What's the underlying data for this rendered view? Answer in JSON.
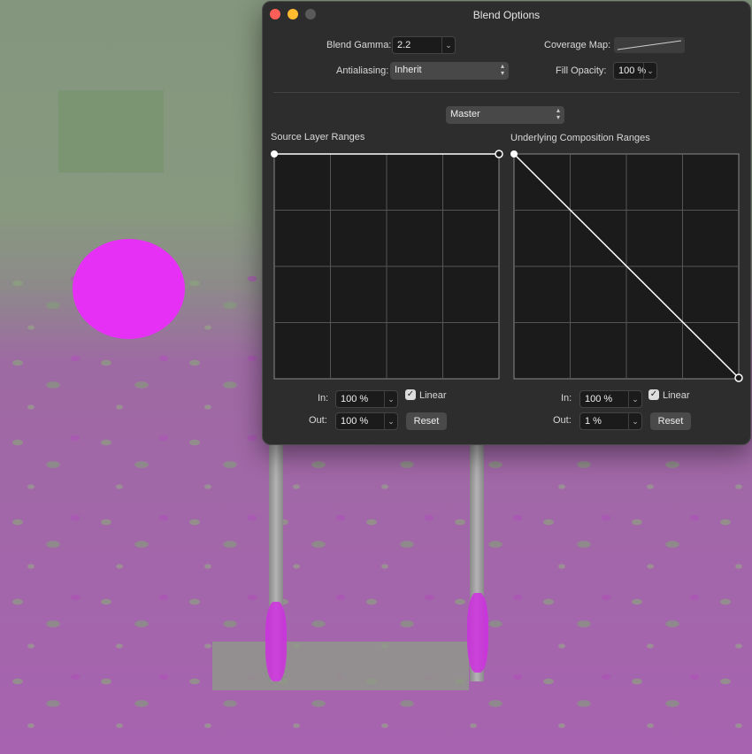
{
  "window": {
    "title": "Blend Options"
  },
  "controls": {
    "blend_gamma": {
      "label": "Blend Gamma:",
      "value": "2.2"
    },
    "coverage_map": {
      "label": "Coverage Map:"
    },
    "antialiasing": {
      "label": "Antialiasing:",
      "value": "Inherit"
    },
    "fill_opacity": {
      "label": "Fill Opacity:",
      "value": "100 %"
    },
    "channel": {
      "value": "Master"
    }
  },
  "source": {
    "title": "Source Layer Ranges",
    "in_label": "In:",
    "in_value": "100 %",
    "out_label": "Out:",
    "out_value": "100 %",
    "linear_label": "Linear",
    "linear_checked": true,
    "reset_label": "Reset"
  },
  "underlying": {
    "title": "Underlying Composition Ranges",
    "in_label": "In:",
    "in_value": "100 %",
    "out_label": "Out:",
    "out_value": "1 %",
    "linear_label": "Linear",
    "linear_checked": true,
    "reset_label": "Reset"
  },
  "icons": {
    "checkmark": "✓",
    "chevron_down": "⌄"
  },
  "colors": {
    "close": "#ff5f57",
    "minimize": "#febc2e",
    "zoom_disabled": "#5a5a5a",
    "panel_bg": "#2d2d2d",
    "graph_bg": "#1b1b1b",
    "canvas_ellipse": "#e630f6"
  }
}
